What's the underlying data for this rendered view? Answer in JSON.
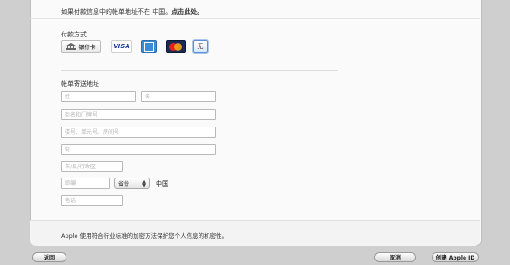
{
  "top_note": {
    "line1": "如果付款信息中的帐单地址不在 中国,请点击此处。",
    "line2_prefix": "如果付款信息中的帐单地址不在 中国。",
    "line2_link": "点击此处。"
  },
  "payment": {
    "title": "付款方式",
    "options": {
      "bank": "银行卡",
      "visa": "VISA",
      "amex": "AMERICAN EXPRESS",
      "mastercard": "MasterCard",
      "none": "无"
    }
  },
  "billing": {
    "title": "帐单寄送地址",
    "last_name_placeholder": "姓",
    "first_name_placeholder": "名",
    "street_placeholder": "街名和门牌号",
    "building_placeholder": "楼号、单元号、房间号",
    "street2_placeholder": "街",
    "city_placeholder": "市/县/行政区",
    "postcode_placeholder": "邮编",
    "province_select": "省份",
    "country": "中国",
    "phone_placeholder": "电话"
  },
  "footer": {
    "privacy": "Apple 使用符合行业标准的加密方法保护您个人信息的机密性。"
  },
  "buttons": {
    "back": "返回",
    "cancel": "取消",
    "create": "创建 Apple ID"
  }
}
